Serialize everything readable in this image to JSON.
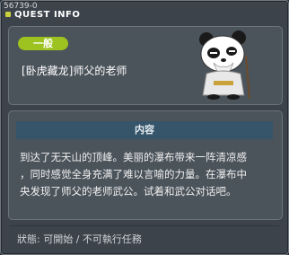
{
  "window": {
    "quest_id": "56739-0",
    "title": "QUEST INFO"
  },
  "quest": {
    "category": "一般",
    "name": "[卧虎藏龙]师父的老师",
    "section_title": "内容",
    "description_lines": [
      "到达了无天山的顶峰。美丽的瀑布带来一阵清凉感",
      "，同时感觉全身充满了难以言喻的力量。在瀑布中",
      "央发现了师父的老师武公。试着和武公对话吧。"
    ],
    "status": "狀態: 可開始 / 不可執行任務"
  },
  "colors": {
    "category_badge": "#9cc31f",
    "section_header": "#36546a"
  },
  "icons": {
    "npc": "panda-master-npc-icon"
  }
}
